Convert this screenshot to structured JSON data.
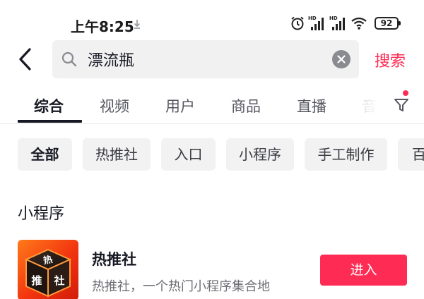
{
  "status_bar": {
    "time": "上午8:25",
    "battery": "92",
    "icons": [
      "download-indicator-icon",
      "alarm-icon",
      "hd-signal-icon",
      "hd-signal-icon",
      "wifi-icon",
      "battery-icon"
    ]
  },
  "search": {
    "back_icon": "chevron-left-icon",
    "query": "漂流瓶",
    "clear_icon": "clear-icon",
    "submit_label": "搜索"
  },
  "tabs": {
    "items": [
      {
        "label": "综合",
        "active": true
      },
      {
        "label": "视频",
        "active": false
      },
      {
        "label": "用户",
        "active": false
      },
      {
        "label": "商品",
        "active": false
      },
      {
        "label": "直播",
        "active": false
      },
      {
        "label": "音",
        "active": false
      }
    ],
    "filter_icon": "filter-icon"
  },
  "chips": [
    {
      "label": "全部",
      "active": true
    },
    {
      "label": "热推社",
      "active": false
    },
    {
      "label": "入口",
      "active": false
    },
    {
      "label": "小程序",
      "active": false
    },
    {
      "label": "手工制作",
      "active": false
    },
    {
      "label": "百",
      "active": false
    }
  ],
  "section": {
    "title": "小程序"
  },
  "mini_program": {
    "name": "热推社",
    "description": "热推社，一个热门小程序集合地",
    "action_label": "进入",
    "logo_text": "热推社"
  },
  "colors": {
    "accent": "#fe2c55",
    "chip_bg": "#f2f2f3",
    "search_bg": "#f1f1f2",
    "text_primary": "#161823",
    "text_secondary": "#6d6e74"
  }
}
